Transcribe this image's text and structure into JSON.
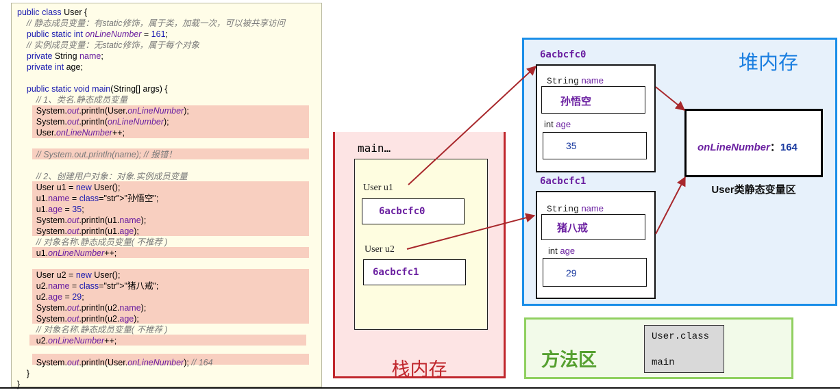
{
  "code": {
    "lines": [
      "public class User {",
      "    // 静态成员变量：有static修饰，属于类，加载一次，可以被共享访问",
      "    public static int onLineNumber = 161;",
      "    // 实例成员变量：无static修饰，属于每个对象",
      "    private String name;",
      "    private int age;",
      "",
      "    public static void main(String[] args) {",
      "        // 1、类名.静态成员变量",
      "        System.out.println(User.onLineNumber);",
      "        System.out.println(onLineNumber);",
      "        User.onLineNumber++;",
      "",
      "        // System.out.println(name); // 报错！",
      "",
      "        // 2、创建用户对象：对象.实例成员变量",
      "        User u1 = new User();",
      "        u1.name = \"孙悟空\";",
      "        u1.age = 35;",
      "        System.out.println(u1.name);",
      "        System.out.println(u1.age);",
      "        // 对象名称.静态成员变量( 不推荐 )",
      "        u1.onLineNumber++;",
      "",
      "        User u2 = new User();",
      "        u2.name = \"猪八戒\";",
      "        u2.age = 29;",
      "        System.out.println(u2.name);",
      "        System.out.println(u2.age);",
      "        // 对象名称.静态成员变量( 不推荐 )",
      "        u2.onLineNumber++;",
      "",
      "        System.out.println(User.onLineNumber); // 164",
      "    }",
      "}"
    ]
  },
  "stack": {
    "title": "栈内存",
    "frame_label": "main…",
    "vars": [
      {
        "label": "User  u1",
        "value": "6acbcfc0"
      },
      {
        "label": "User u2",
        "value": "6acbcfc1"
      }
    ]
  },
  "heap": {
    "title": "堆内存",
    "objects": [
      {
        "address": "6acbcfc0",
        "name_type": "String",
        "name_field": "name",
        "name_value": "孙悟空",
        "age_type": "int",
        "age_field": "age",
        "age_value": "35"
      },
      {
        "address": "6acbcfc1",
        "name_type": "String",
        "name_field": "name",
        "name_value": "猪八戒",
        "age_type": "int",
        "age_field": "age",
        "age_value": "29"
      }
    ],
    "static_area": {
      "field": "onLineNumber",
      "separator": "：",
      "value": "164",
      "caption": "User类静态变量区"
    }
  },
  "method_area": {
    "title": "方法区",
    "items": [
      "User.class",
      "main"
    ]
  },
  "colors": {
    "stack_border": "#c0262c",
    "heap_border": "#1a8ee8",
    "method_border": "#90d060",
    "arrow": "#a8282c",
    "field_purple": "#6a1fa0"
  }
}
